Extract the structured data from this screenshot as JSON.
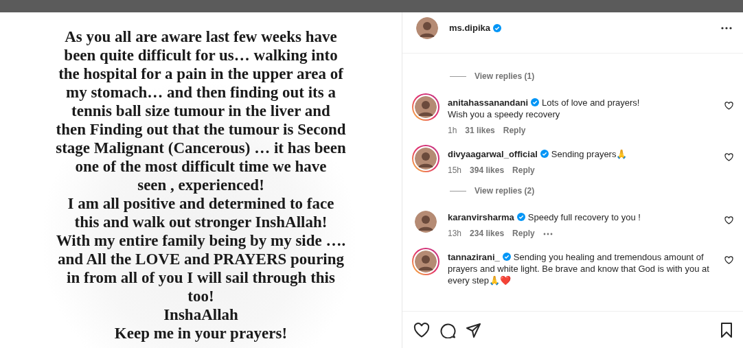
{
  "post": {
    "lines": [
      "As you all are aware last few weeks have",
      "been quite difficult for us… walking into",
      "the hospital for a pain in the upper area of",
      "my stomach… and then finding out its a",
      "tennis ball size tumour in the liver and",
      "then Finding out that the tumour is Second",
      "stage Malignant (Cancerous) … it has been",
      "one of the most difficult time we have",
      "seen , experienced!",
      "I am all positive and determined to face",
      "this and walk out stronger InshAllah!",
      "With my entire family being by my side ….",
      "and All the LOVE and PRAYERS pouring",
      "in from all of you I will sail through this",
      "too!",
      "InshaAllah",
      "Keep me in your prayers!"
    ]
  },
  "header": {
    "username": "ms.dipika",
    "verified": true,
    "story_ring": false
  },
  "comments": [
    {
      "kind": "view_replies",
      "label": "View replies (1)"
    },
    {
      "kind": "comment",
      "username": "anitahassanandani",
      "verified": true,
      "story_ring": true,
      "text": "Lots of love and prayers!\nWish you a speedy recovery",
      "time": "1h",
      "likes": "31 likes",
      "reply": "Reply"
    },
    {
      "kind": "comment",
      "username": "divyaagarwal_official",
      "verified": true,
      "story_ring": true,
      "text": "Sending prayers🙏",
      "time": "15h",
      "likes": "394 likes",
      "reply": "Reply"
    },
    {
      "kind": "view_replies",
      "label": "View replies (2)"
    },
    {
      "kind": "comment",
      "username": "karanvirsharma",
      "verified": true,
      "story_ring": false,
      "text": "Speedy full recovery to you !",
      "time": "13h",
      "likes": "234 likes",
      "reply": "Reply",
      "more": true
    },
    {
      "kind": "comment",
      "username": "tannazirani_",
      "verified": true,
      "story_ring": true,
      "text": "Sending you healing and tremendous amount of prayers and white light. Be brave and know that God is with you at every step🙏❤️"
    }
  ]
}
